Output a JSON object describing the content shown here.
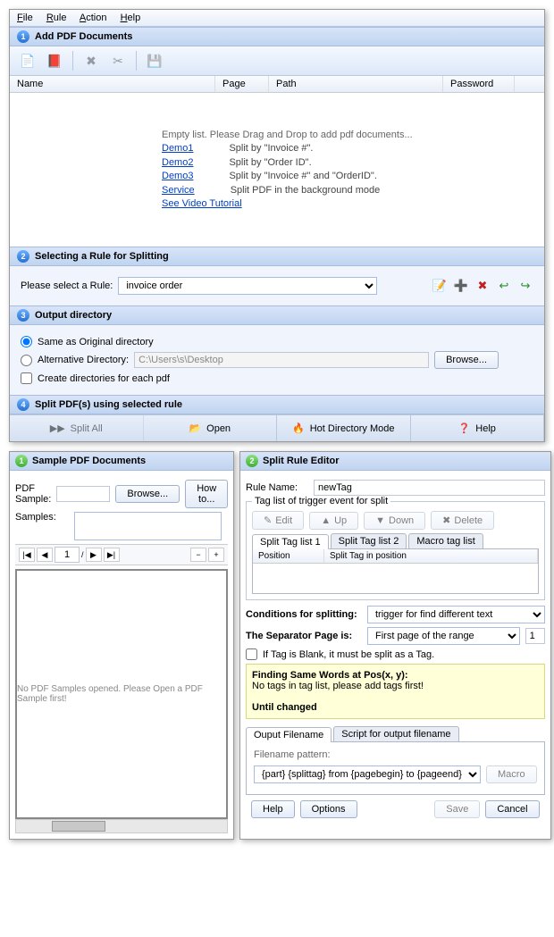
{
  "menubar": [
    "File",
    "Rule",
    "Action",
    "Help"
  ],
  "sec1": {
    "num": "1",
    "title": "Add PDF Documents"
  },
  "listcols": {
    "name": "Name",
    "page": "Page",
    "path": "Path",
    "pwd": "Password"
  },
  "empty": {
    "msg": "Empty list. Please Drag and Drop to add pdf documents...",
    "demos": [
      {
        "link": "Demo1",
        "desc": "Split by \"Invoice #\"."
      },
      {
        "link": "Demo2",
        "desc": "Split by \"Order ID\"."
      },
      {
        "link": "Demo3",
        "desc": "Split by \"Invoice #\" and \"OrderID\"."
      },
      {
        "link": "Service",
        "desc": "Split PDF in the background mode"
      }
    ],
    "tutorial": "See Video Tutorial"
  },
  "sec2": {
    "num": "2",
    "title": "Selecting a Rule for Splitting",
    "label": "Please select a Rule:",
    "value": "invoice order"
  },
  "sec3": {
    "num": "3",
    "title": "Output directory",
    "opt1": "Same as Original directory",
    "opt2": "Alternative Directory:",
    "path": "C:\\Users\\s\\Desktop",
    "browse": "Browse...",
    "chk": "Create directories for each pdf"
  },
  "sec4": {
    "num": "4",
    "title": "Split PDF(s) using selected rule"
  },
  "actions": {
    "split": "Split All",
    "open": "Open",
    "hot": "Hot Directory Mode",
    "help": "Help"
  },
  "left": {
    "title": "Sample PDF Documents",
    "pdfsample": "PDF Sample:",
    "browse": "Browse...",
    "howto": "How to...",
    "samples": "Samples:",
    "page": "1",
    "empty": "No PDF Samples opened. Please Open a PDF Sample first!"
  },
  "right": {
    "title": "Split Rule Editor",
    "rulename_lbl": "Rule Name:",
    "rulename": "newTag",
    "taglist_legend": "Tag list of trigger event for split",
    "btns": {
      "edit": "Edit",
      "up": "Up",
      "down": "Down",
      "delete": "Delete"
    },
    "tabs": [
      "Split Tag list 1",
      "Split Tag list 2",
      "Macro tag list"
    ],
    "thdr": {
      "pos": "Position",
      "tag": "Split Tag in position"
    },
    "cond_lbl": "Conditions for splitting:",
    "cond_val": "trigger for find different text",
    "sep_lbl": "The Separator Page is:",
    "sep_val": "First page of the range",
    "sep_num": "1",
    "blank_chk": "If Tag is Blank, it must be split as a Tag.",
    "yellow": {
      "h": "Finding Same Words at Pos(x, y):",
      "msg": "No tags in tag list, please add tags first!",
      "until": "Until changed"
    },
    "out_tabs": [
      "Ouput Filename",
      "Script for output filename"
    ],
    "pattern_lbl": "Filename pattern:",
    "pattern": "{part} {splittag} from {pagebegin} to {pageend}",
    "macro": "Macro",
    "help": "Help",
    "options": "Options",
    "save": "Save",
    "cancel": "Cancel"
  }
}
